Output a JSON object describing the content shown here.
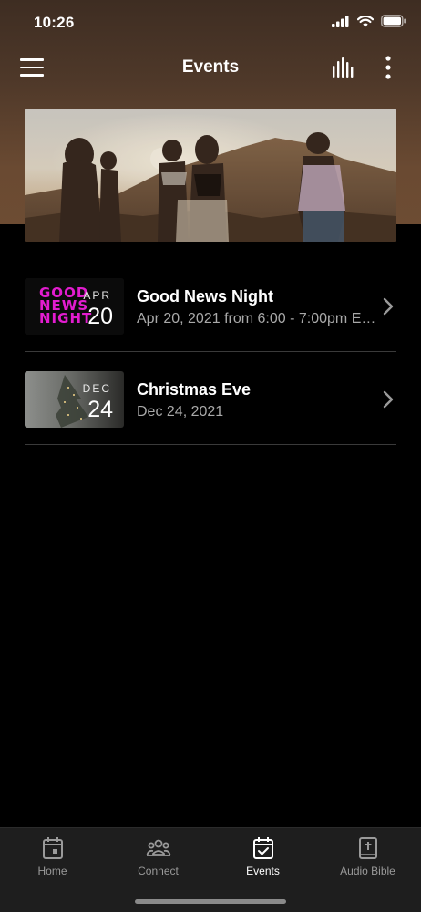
{
  "status_bar": {
    "time": "10:26"
  },
  "header": {
    "title": "Events"
  },
  "events": [
    {
      "title": "Good News Night",
      "subtitle": "Apr 20, 2021 from 6:00 - 7:00pm E…",
      "thumb_month": "APR",
      "thumb_day": "20",
      "thumb_logo": [
        "GOOD",
        "NEWS",
        "NIGHT"
      ]
    },
    {
      "title": "Christmas Eve",
      "subtitle": "Dec 24, 2021",
      "thumb_month": "DEC",
      "thumb_day": "24"
    }
  ],
  "tab_bar": {
    "items": [
      {
        "label": "Home",
        "icon": "calendar-home-icon",
        "active": false
      },
      {
        "label": "Connect",
        "icon": "people-icon",
        "active": false
      },
      {
        "label": "Events",
        "icon": "calendar-check-icon",
        "active": true
      },
      {
        "label": "Audio Bible",
        "icon": "bible-icon",
        "active": false
      }
    ]
  },
  "colors": {
    "header_brown": "#4e3829",
    "background": "#000000",
    "tab_bar": "#1e1e1e",
    "thumb_magenta": "#e21ccf"
  }
}
